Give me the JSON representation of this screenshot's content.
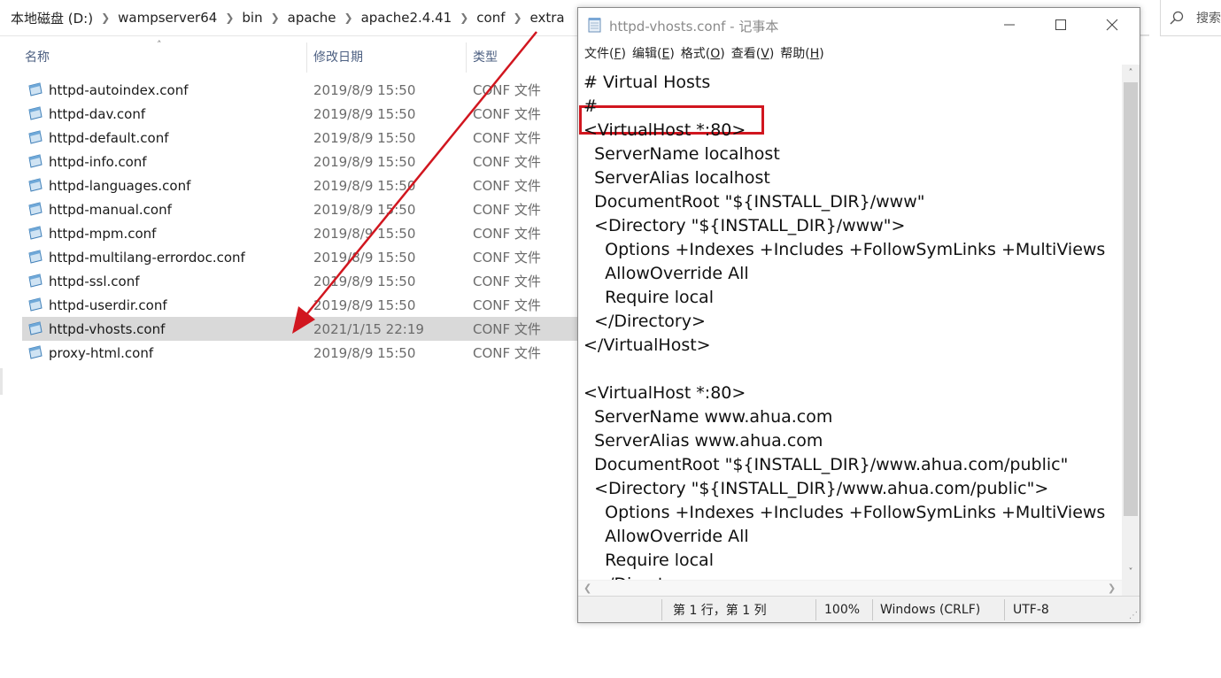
{
  "explorer": {
    "breadcrumb": [
      "本地磁盘 (D:)",
      "wampserver64",
      "bin",
      "apache",
      "apache2.4.41",
      "conf",
      "extra"
    ],
    "search_placeholder": "搜索",
    "columns": {
      "name": "名称",
      "date": "修改日期",
      "type": "类型"
    },
    "files": [
      {
        "name": "httpd-autoindex.conf",
        "date": "2019/8/9 15:50",
        "type": "CONF 文件"
      },
      {
        "name": "httpd-dav.conf",
        "date": "2019/8/9 15:50",
        "type": "CONF 文件"
      },
      {
        "name": "httpd-default.conf",
        "date": "2019/8/9 15:50",
        "type": "CONF 文件"
      },
      {
        "name": "httpd-info.conf",
        "date": "2019/8/9 15:50",
        "type": "CONF 文件"
      },
      {
        "name": "httpd-languages.conf",
        "date": "2019/8/9 15:50",
        "type": "CONF 文件"
      },
      {
        "name": "httpd-manual.conf",
        "date": "2019/8/9 15:50",
        "type": "CONF 文件"
      },
      {
        "name": "httpd-mpm.conf",
        "date": "2019/8/9 15:50",
        "type": "CONF 文件"
      },
      {
        "name": "httpd-multilang-errordoc.conf",
        "date": "2019/8/9 15:50",
        "type": "CONF 文件"
      },
      {
        "name": "httpd-ssl.conf",
        "date": "2019/8/9 15:50",
        "type": "CONF 文件"
      },
      {
        "name": "httpd-userdir.conf",
        "date": "2019/8/9 15:50",
        "type": "CONF 文件"
      },
      {
        "name": "httpd-vhosts.conf",
        "date": "2021/1/15 22:19",
        "type": "CONF 文件",
        "selected": true
      },
      {
        "name": "proxy-html.conf",
        "date": "2019/8/9 15:50",
        "type": "CONF 文件"
      }
    ]
  },
  "notepad": {
    "title": "httpd-vhosts.conf - 记事本",
    "menus": [
      {
        "label": "文件(",
        "key": "F",
        "end": ")"
      },
      {
        "label": "编辑(",
        "key": "E",
        "end": ")"
      },
      {
        "label": "格式(",
        "key": "O",
        "end": ")"
      },
      {
        "label": "查看(",
        "key": "V",
        "end": ")"
      },
      {
        "label": "帮助(",
        "key": "H",
        "end": ")"
      }
    ],
    "lines": [
      "# Virtual Hosts",
      "#",
      "<VirtualHost *:80>",
      "  ServerName localhost",
      "  ServerAlias localhost",
      "  DocumentRoot \"${INSTALL_DIR}/www\"",
      "  <Directory \"${INSTALL_DIR}/www\">",
      "    Options +Indexes +Includes +FollowSymLinks +MultiViews",
      "    AllowOverride All",
      "    Require local",
      "  </Directory>",
      "</VirtualHost>",
      "",
      "<VirtualHost *:80>",
      "  ServerName www.ahua.com",
      "  ServerAlias www.ahua.com",
      "  DocumentRoot \"${INSTALL_DIR}/www.ahua.com/public\"",
      "  <Directory \"${INSTALL_DIR}/www.ahua.com/public\">",
      "    Options +Indexes +Includes +FollowSymLinks +MultiViews",
      "    AllowOverride All",
      "    Require local",
      "  </Directory>"
    ],
    "status": {
      "position": "第 1 行，第 1 列",
      "zoom": "100%",
      "line_ending": "Windows (CRLF)",
      "encoding": "UTF-8"
    }
  },
  "colors": {
    "annotation_red": "#d1161f",
    "selected_row": "#d9d9d9",
    "header_text": "#4d6082"
  },
  "icons": [
    "chevron-right-icon",
    "search-icon",
    "conf-file-icon",
    "notepad-icon",
    "minimize-icon",
    "maximize-icon",
    "close-icon"
  ]
}
